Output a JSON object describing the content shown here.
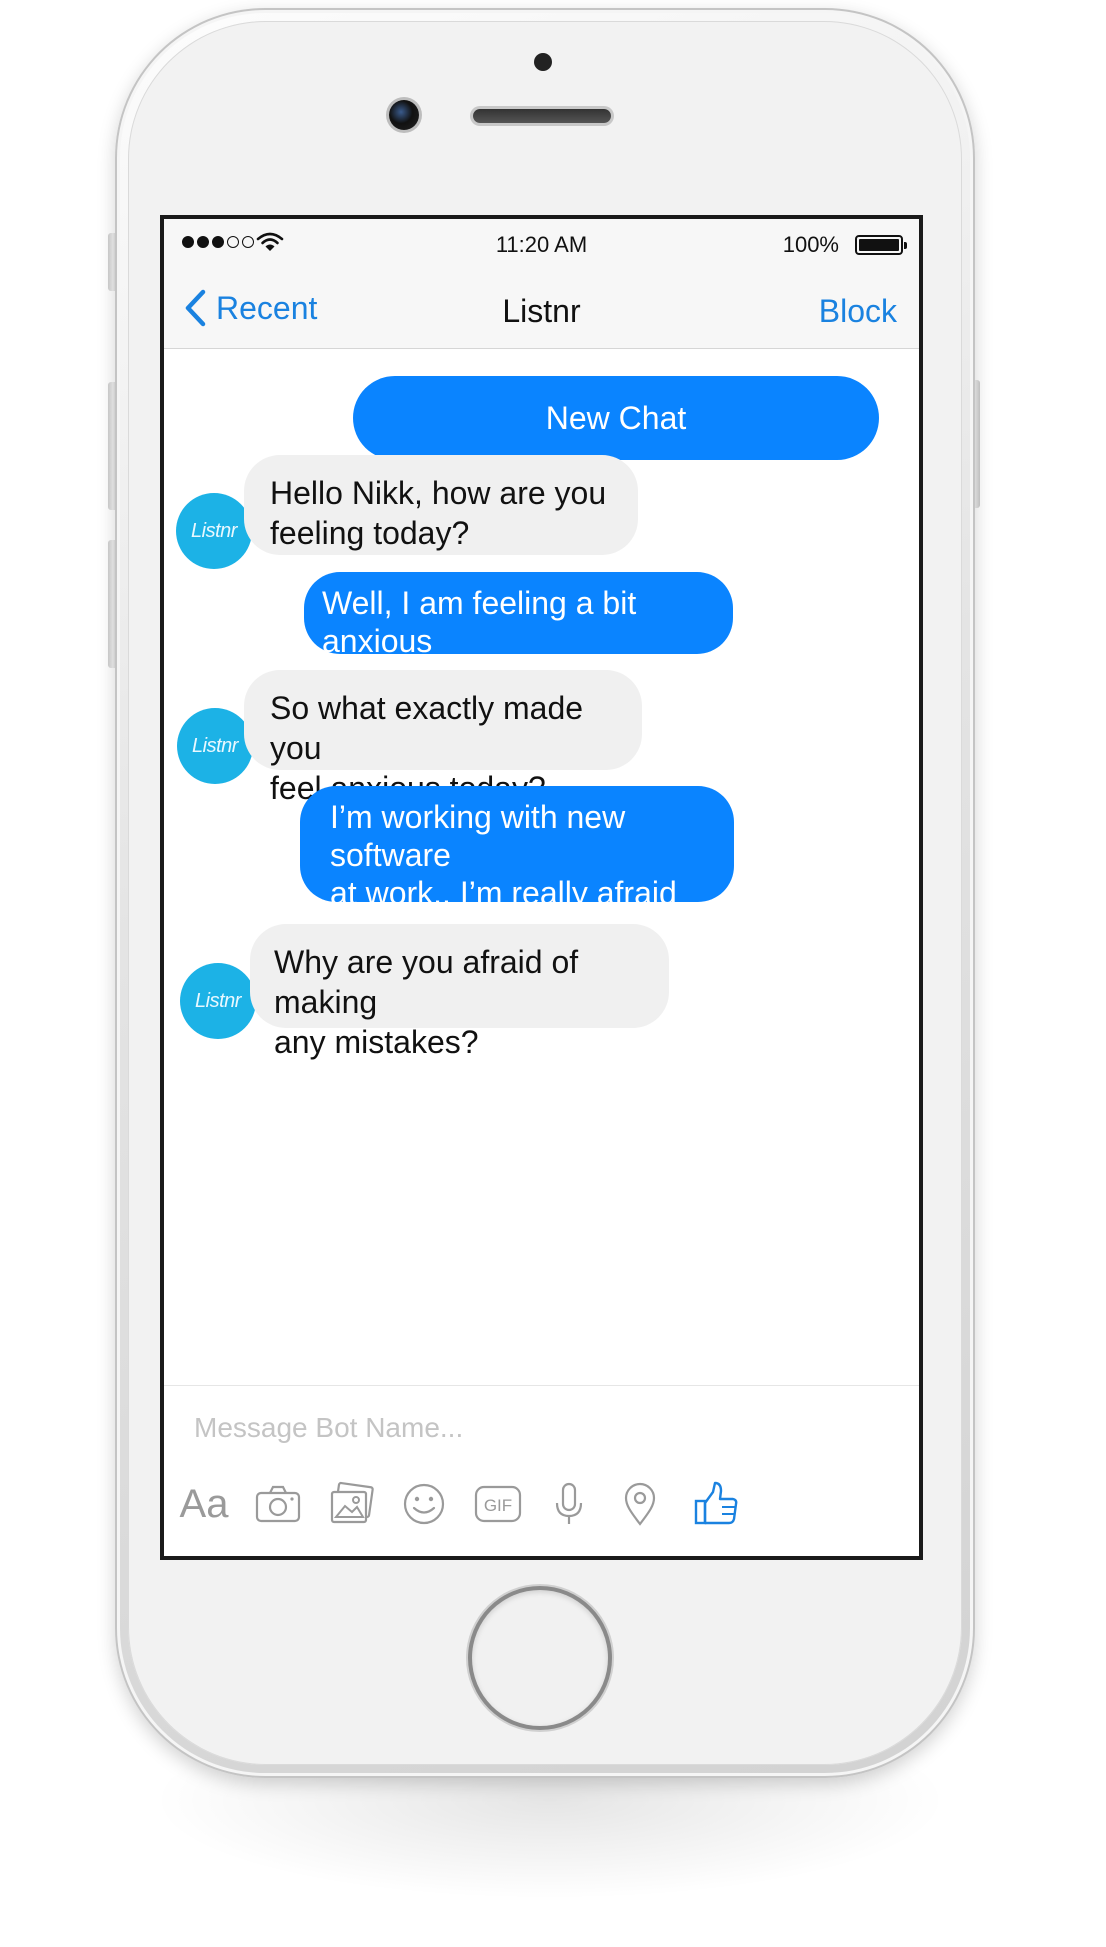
{
  "status_bar": {
    "time": "11:20 AM",
    "battery_percent": "100%",
    "signal_bars_filled": 3,
    "signal_bars_total": 5
  },
  "nav": {
    "back_label": "Recent",
    "title": "Listnr",
    "action_label": "Block"
  },
  "chat": {
    "new_chat_label": "New Chat",
    "avatar_label": "Listnr",
    "messages": [
      {
        "sender": "bot",
        "text": "Hello Nikk, how are you\nfeeling today?"
      },
      {
        "sender": "user",
        "text": "Well, I am feeling a bit anxious\nfor some reason today."
      },
      {
        "sender": "bot",
        "text": "So what exactly made you\nfeel anxious today?"
      },
      {
        "sender": "user",
        "text": "I’m working with new software\nat work.. I’m really afraid\nto make mistakes."
      },
      {
        "sender": "bot",
        "text": "Why are you afraid of making\nany mistakes?"
      }
    ]
  },
  "composer": {
    "placeholder": "Message Bot Name...",
    "value": "",
    "text_format_label": "Aa",
    "gif_label": "GIF"
  },
  "colors": {
    "accent": "#0a84ff",
    "link": "#1a82e0",
    "bot_bubble": "#f0f0f0",
    "avatar": "#1cb2e6",
    "like_icon": "#1a82e0",
    "toolbar_icon": "#9a9a9a"
  }
}
